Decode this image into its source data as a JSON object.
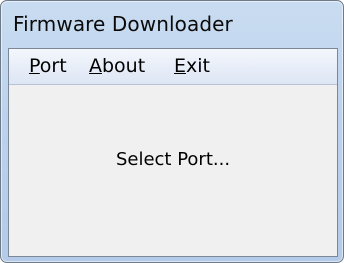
{
  "window": {
    "title": "Firmware Downloader"
  },
  "menubar": {
    "items": [
      {
        "label": "Port",
        "mnemonic": "P",
        "rest": "ort"
      },
      {
        "label": "About",
        "mnemonic": "A",
        "rest": "bout"
      },
      {
        "label": "Exit",
        "mnemonic": "E",
        "rest": "xit"
      }
    ]
  },
  "main": {
    "status": "Select Port..."
  }
}
